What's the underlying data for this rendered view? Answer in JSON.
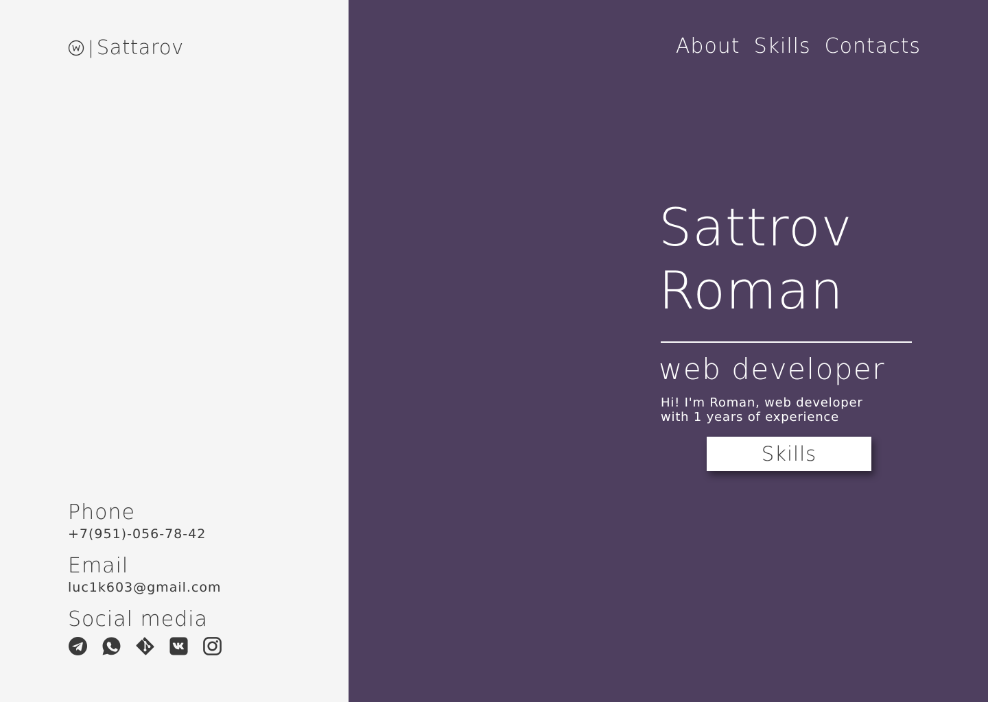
{
  "header": {
    "logo_text": "Sattarov",
    "logo_separator": "|",
    "nav": [
      {
        "label": "About"
      },
      {
        "label": "Skills"
      },
      {
        "label": "Contacts"
      }
    ]
  },
  "hero": {
    "name_line1": "Sattrov",
    "name_line2": "Roman",
    "role": "web developer",
    "description": "Hi! I'm Roman, web developer with 1 years of experience",
    "button_label": "Skills"
  },
  "contacts": {
    "phone_label": "Phone",
    "phone_value": "+7(951)-056-78-42",
    "email_label": "Email",
    "email_value": "luc1k603@gmail.com",
    "social_label": "Social media",
    "socials": [
      {
        "icon": "telegram-icon"
      },
      {
        "icon": "whatsapp-icon"
      },
      {
        "icon": "git-icon"
      },
      {
        "icon": "vk-icon"
      },
      {
        "icon": "instagram-icon"
      }
    ]
  },
  "colors": {
    "panel_purple": "#4e3f5f",
    "panel_light": "#f5f5f5",
    "text_dark": "#3a3a3a",
    "text_light": "#ffffff"
  }
}
